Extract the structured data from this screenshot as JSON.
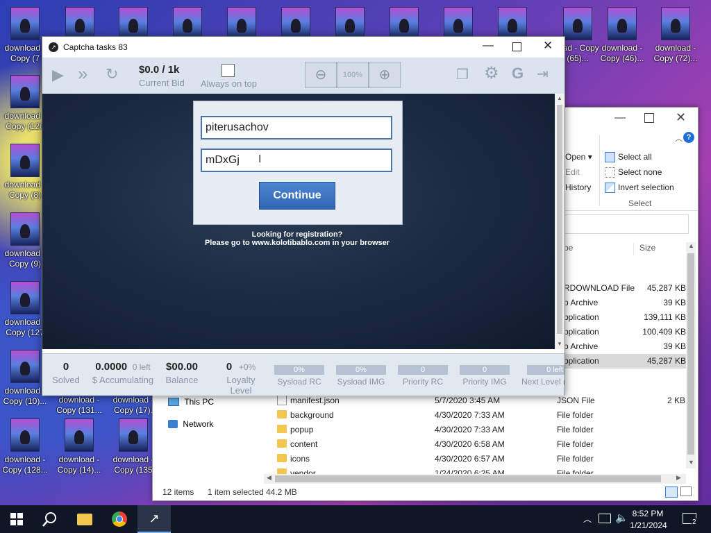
{
  "desktop": {
    "icons": [
      {
        "label": "download - Copy (7"
      },
      {
        "label": "download - Copy (126"
      },
      {
        "label": "download - Copy (8)"
      },
      {
        "label": "download - Copy (9)"
      },
      {
        "label": "download - Copy (127"
      },
      {
        "label": "download - Copy (10)..."
      },
      {
        "label": "download - Copy (128..."
      },
      {
        "label": "download - Copy (131..."
      },
      {
        "label": "download - Copy (14)..."
      },
      {
        "label": "download - Copy (17)."
      },
      {
        "label": "download - Copy (135"
      },
      {
        "label": "load - Copy (65)..."
      },
      {
        "label": "download - Copy (46)..."
      },
      {
        "label": "download - Copy (72)..."
      }
    ]
  },
  "captcha_window": {
    "title": "Captcha tasks 83",
    "bid_value": "$0.0 / 1k",
    "bid_label": "Current Bid",
    "always_on_top_label": "Always on top",
    "zoom": "100%",
    "username": "piterusachov",
    "password": "mDxGj",
    "continue_label": "Continue",
    "registration_line1": "Looking for registration?",
    "registration_line2": "Please go to www.kolotibablo.com in your browser",
    "stats": {
      "solved_value": "0",
      "solved_label": "Solved",
      "accum_value": "0.0000",
      "accum_left": "0 left",
      "accum_label": "$ Accumulating",
      "balance_value": "$00.00",
      "balance_label": "Balance",
      "loyalty_value": "0",
      "loyalty_pct": "+0%",
      "loyalty_label": "Loyalty Level",
      "sysload_rc_value": "0%",
      "sysload_rc_label": "Sysload RC",
      "sysload_img_value": "0%",
      "sysload_img_label": "Sysload IMG",
      "priority_rc_value": "0",
      "priority_rc_label": "Priority RC",
      "priority_img_value": "0",
      "priority_img_label": "Priority IMG",
      "next_level_value": "0 left",
      "next_level_label": "Next Level ("
    }
  },
  "explorer": {
    "ribbon": {
      "open": "Open ▾",
      "edit": "Edit",
      "history": "History",
      "select_all": "Select all",
      "select_none": "Select none",
      "invert_selection": "Invert selection",
      "group_select": "Select"
    },
    "columns": {
      "type": "pe",
      "size": "Size"
    },
    "top_rows": [
      {
        "type": "RDOWNLOAD File",
        "size": "45,287 KB"
      },
      {
        "type": "p Archive",
        "size": "39 KB"
      },
      {
        "type": "pplication",
        "size": "139,111 KB"
      },
      {
        "type": "pplication",
        "size": "100,409 KB"
      },
      {
        "type": "p Archive",
        "size": "39 KB"
      },
      {
        "type": "pplication",
        "size": "45,287 KB"
      }
    ],
    "nav": {
      "this_pc": "This PC",
      "network": "Network"
    },
    "files": [
      {
        "name": "manifest.json",
        "date": "5/7/2020 3:45 AM",
        "type": "JSON File",
        "size": "2 KB"
      },
      {
        "name": "background",
        "date": "4/30/2020 7:33 AM",
        "type": "File folder",
        "size": ""
      },
      {
        "name": "popup",
        "date": "4/30/2020 7:33 AM",
        "type": "File folder",
        "size": ""
      },
      {
        "name": "content",
        "date": "4/30/2020 6:58 AM",
        "type": "File folder",
        "size": ""
      },
      {
        "name": "icons",
        "date": "4/30/2020 6:57 AM",
        "type": "File folder",
        "size": ""
      },
      {
        "name": "vendor",
        "date": "1/24/2020 6:25 AM",
        "type": "File folder",
        "size": ""
      }
    ],
    "status_items": "12 items",
    "status_selected": "1 item selected",
    "status_size": "44.2 MB"
  },
  "taskbar": {
    "time": "8:52 PM",
    "date": "1/21/2024",
    "notifications": "2"
  }
}
